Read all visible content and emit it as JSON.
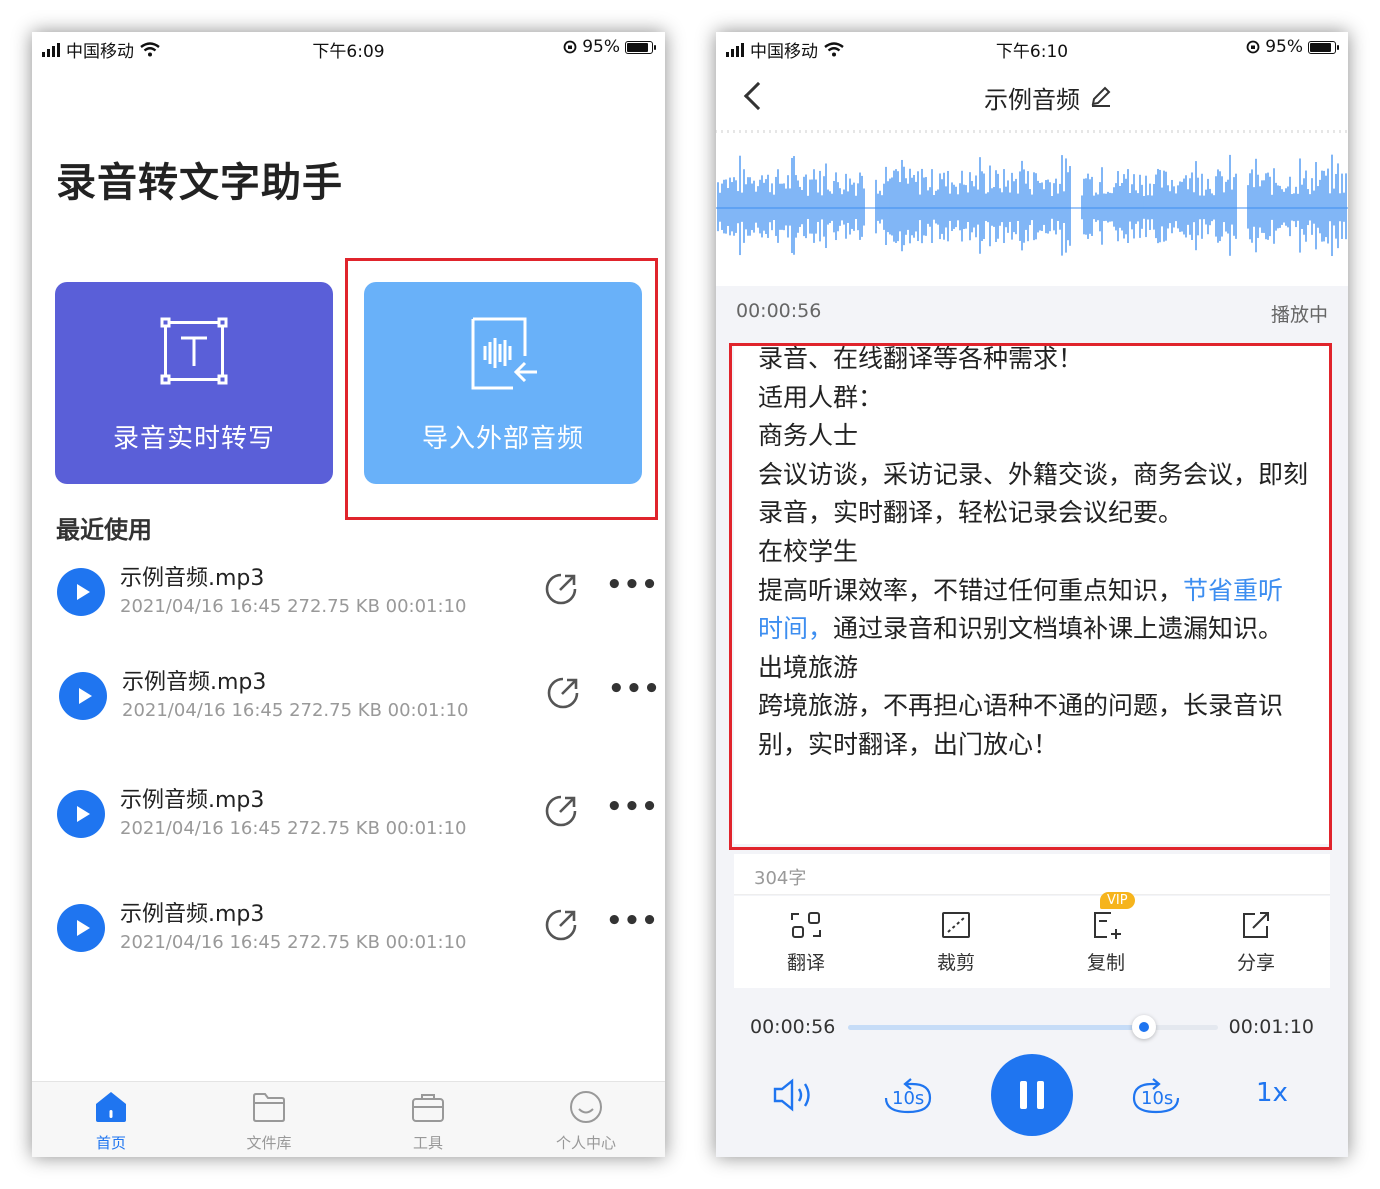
{
  "left_screen": {
    "status": {
      "carrier": "中国移动",
      "time": "下午6:09",
      "battery": "95%"
    },
    "app_title": "录音转文字助手",
    "cards": {
      "realtime": "录音实时转写",
      "import": "导入外部音频"
    },
    "section_title": "最近使用",
    "recent": [
      {
        "name": "示例音频.mp3",
        "meta": "2021/04/16 16:45  272.75 KB  00:01:10"
      },
      {
        "name": "示例音频.mp3",
        "meta": "2021/04/16 16:45  272.75 KB  00:01:10"
      },
      {
        "name": "示例音频.mp3",
        "meta": "2021/04/16 16:45  272.75 KB  00:01:10"
      },
      {
        "name": "示例音频.mp3",
        "meta": "2021/04/16 16:45  272.75 KB  00:01:10"
      }
    ],
    "more_label": "•••",
    "tabs": [
      {
        "label": "首页",
        "icon": "home-icon",
        "active": true
      },
      {
        "label": "文件库",
        "icon": "folder-icon",
        "active": false
      },
      {
        "label": "工具",
        "icon": "toolbox-icon",
        "active": false
      },
      {
        "label": "个人中心",
        "icon": "profile-icon",
        "active": false
      }
    ]
  },
  "right_screen": {
    "status": {
      "carrier": "中国移动",
      "time": "下午6:10",
      "battery": "95%"
    },
    "nav_title": "示例音频",
    "elapsed": "00:00:56",
    "play_state": "播放中",
    "transcript": {
      "line_0": "录音、在线翻译等各种需求！",
      "line_1": "适用人群：",
      "line_2": "商务人士",
      "line_3": "会议访谈，采访记录、外籍交谈，商务会议，即刻录音，实时翻译，轻松记录会议纪要。",
      "line_4": "在校学生",
      "line_5_a": "提高听课效率，不错过任何重点知识，",
      "line_5_hl": "节省重听时间，",
      "line_5_b": "通过录音和识别文档填补课上遗漏知识。",
      "line_6": "出境旅游",
      "line_7": "跨境旅游，不再担心语种不通的问题，长录音识别，实时翻译，出门放心！"
    },
    "char_count": "304字",
    "tools": [
      {
        "label": "翻译",
        "icon": "translate-icon"
      },
      {
        "label": "裁剪",
        "icon": "crop-icon"
      },
      {
        "label": "复制",
        "icon": "copy-icon",
        "badge": "VIP"
      },
      {
        "label": "分享",
        "icon": "share-icon"
      }
    ],
    "player": {
      "current": "00:00:56",
      "total": "00:01:10",
      "progress": 0.8,
      "rewind_label": "10s",
      "forward_label": "10s",
      "speed": "1x"
    },
    "colors": {
      "accent": "#1f75f0",
      "highlight": "#3d8ef0",
      "vip": "#f6b41c",
      "card_purple": "#5a5fd8",
      "card_blue": "#69b1f9",
      "annotation_red": "#e0242c"
    }
  }
}
